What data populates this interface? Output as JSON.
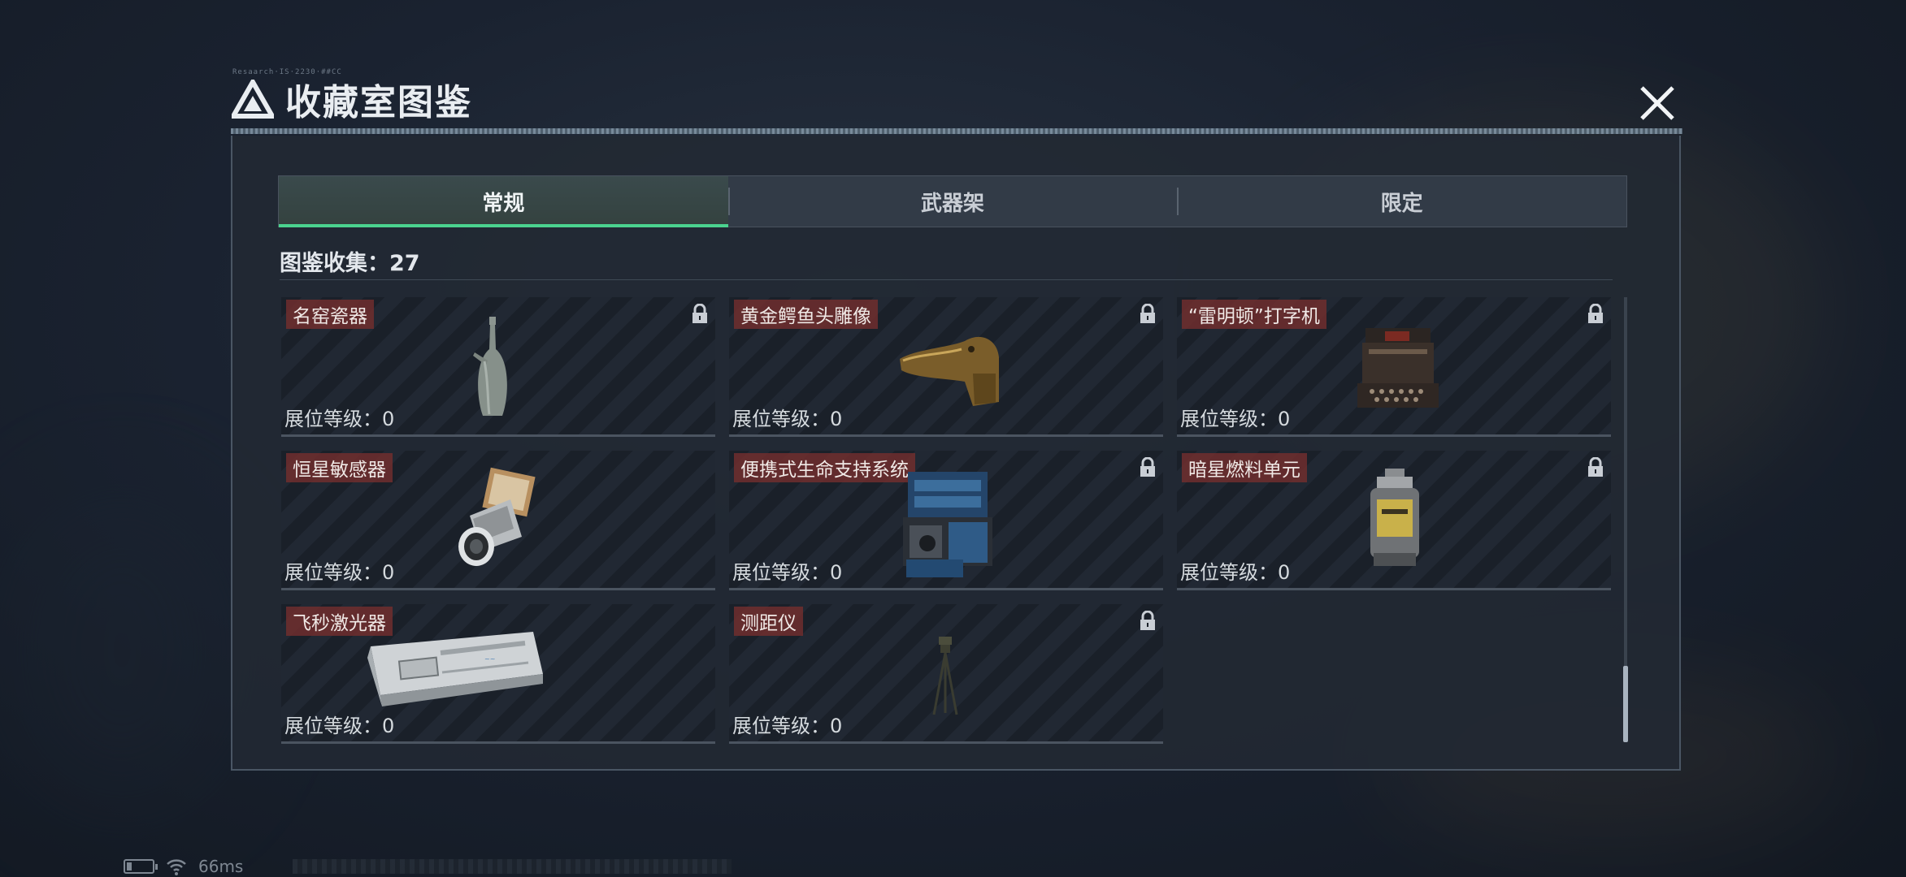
{
  "header": {
    "title": "收藏室图鉴",
    "tiny_code": "Resaarch·IS·2230·##CC"
  },
  "tabs": [
    {
      "label": "常规",
      "active": true
    },
    {
      "label": "武器架",
      "active": false
    },
    {
      "label": "限定",
      "active": false
    }
  ],
  "collection": {
    "label": "图鉴收集：27"
  },
  "items": [
    {
      "name": "名窑瓷器",
      "level": "展位等级：0",
      "locked": true,
      "icon": "porcelain-vase-icon"
    },
    {
      "name": "黄金鳄鱼头雕像",
      "level": "展位等级：0",
      "locked": true,
      "icon": "crocodile-head-statue-icon"
    },
    {
      "name": "“雷明顿”打字机",
      "level": "展位等级：0",
      "locked": true,
      "icon": "typewriter-icon"
    },
    {
      "name": "恒星敏感器",
      "level": "展位等级：0",
      "locked": false,
      "icon": "star-sensor-icon"
    },
    {
      "name": "便携式生命支持系统",
      "level": "展位等级：0",
      "locked": true,
      "icon": "life-support-icon"
    },
    {
      "name": "暗星燃料单元",
      "level": "展位等级：0",
      "locked": true,
      "icon": "fuel-cell-icon"
    },
    {
      "name": "飞秒激光器",
      "level": "展位等级：0",
      "locked": false,
      "icon": "femtosecond-laser-icon"
    },
    {
      "name": "测距仪",
      "level": "展位等级：0",
      "locked": true,
      "icon": "rangefinder-tripod-icon"
    }
  ],
  "status": {
    "ping": "66ms"
  },
  "colors": {
    "accent": "#4bd38f",
    "label_bg": "#702e2e",
    "panel_bg": "#222933"
  }
}
